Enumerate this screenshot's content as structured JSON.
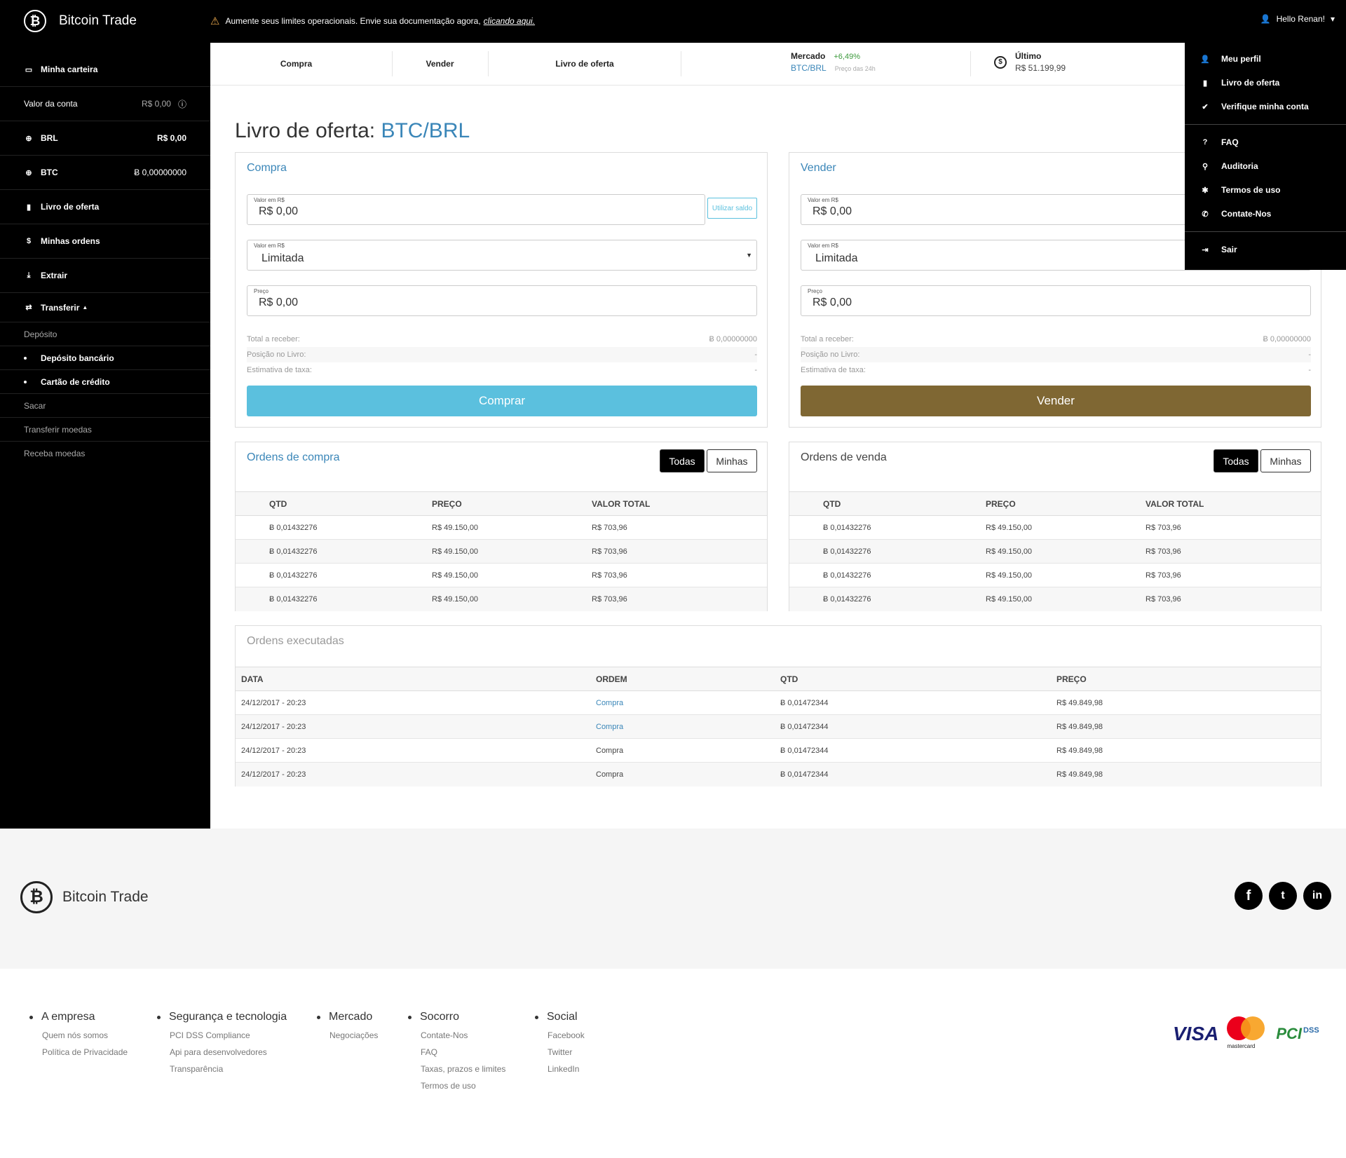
{
  "brand": {
    "name": "Bitcoin Trade",
    "logo_glyph": "₿"
  },
  "alert": {
    "text": "Aumente seus limites operacionais. Envie sua documentação agora,",
    "link": "clicando aqui."
  },
  "user": {
    "greeting": "Hello Renan!"
  },
  "sidebar": {
    "wallet": "Minha carteira",
    "account_value_label": "Valor da conta",
    "account_value": "R$ 0,00",
    "brl_label": "BRL",
    "brl_value": "R$ 0,00",
    "btc_label": "BTC",
    "btc_value": "Ƀ 0,00000000",
    "book": "Livro de oferta",
    "orders": "Minhas ordens",
    "extract": "Extrair",
    "transfer": "Transferir",
    "sub": [
      "Depósito",
      "Depósito bancário",
      "Cartão de crédito",
      "Sacar",
      "Transferir moedas",
      "Receba moedas"
    ]
  },
  "subnav": {
    "tabs": [
      "Compra",
      "Vender",
      "Livro de oferta"
    ],
    "market_label": "Mercado",
    "market_pct": "+6,49%",
    "market_pair": "BTC/BRL",
    "market_sub": "Preço das 24h",
    "last_label": "Último",
    "last_value": "R$ 51.199,99"
  },
  "page": {
    "title": "Livro de oferta:",
    "pair": "BTC/BRL"
  },
  "buy_form": {
    "title": "Compra",
    "value_label": "Valor em R$",
    "value": "R$ 0,00",
    "use_balance": "Utilizar saldo",
    "type_label": "Valor em R$",
    "type_value": "Limitada",
    "price_label": "Preço",
    "price_value": "R$ 0,00",
    "total_label": "Total a receber:",
    "total_value": "Ƀ 0,00000000",
    "position_label": "Posição no Livro:",
    "position_value": "-",
    "fee_label": "Estimativa de taxa:",
    "fee_value": "-",
    "button": "Comprar"
  },
  "sell_form": {
    "title": "Vender",
    "value_label": "Valor em R$",
    "value": "R$ 0,00",
    "type_label": "Valor em R$",
    "type_value": "Limitada",
    "price_label": "Preço",
    "price_value": "R$ 0,00",
    "total_label": "Total a receber:",
    "total_value": "Ƀ 0,00000000",
    "position_label": "Posição no Livro:",
    "position_value": "-",
    "fee_label": "Estimativa de taxa:",
    "fee_value": "-",
    "button": "Vender"
  },
  "buy_orders": {
    "title": "Ordens de compra",
    "all": "Todas",
    "mine": "Minhas",
    "headers": [
      "QTD",
      "PREÇO",
      "VALOR TOTAL"
    ],
    "rows": [
      [
        "Ƀ 0,01432276",
        "R$ 49.150,00",
        "R$ 703,96"
      ],
      [
        "Ƀ 0,01432276",
        "R$ 49.150,00",
        "R$ 703,96"
      ],
      [
        "Ƀ 0,01432276",
        "R$ 49.150,00",
        "R$ 703,96"
      ],
      [
        "Ƀ 0,01432276",
        "R$ 49.150,00",
        "R$ 703,96"
      ]
    ]
  },
  "sell_orders": {
    "title": "Ordens de venda",
    "all": "Todas",
    "mine": "Minhas",
    "headers": [
      "QTD",
      "PREÇO",
      "VALOR TOTAL"
    ],
    "rows": [
      [
        "Ƀ 0,01432276",
        "R$ 49.150,00",
        "R$ 703,96"
      ],
      [
        "Ƀ 0,01432276",
        "R$ 49.150,00",
        "R$ 703,96"
      ],
      [
        "Ƀ 0,01432276",
        "R$ 49.150,00",
        "R$ 703,96"
      ],
      [
        "Ƀ 0,01432276",
        "R$ 49.150,00",
        "R$ 703,96"
      ]
    ]
  },
  "executed": {
    "title": "Ordens executadas",
    "headers": [
      "DATA",
      "ORDEM",
      "QTD",
      "PREÇO"
    ],
    "rows": [
      [
        "24/12/2017 - 20:23",
        "Compra",
        "Ƀ 0,01472344",
        "R$ 49.849,98"
      ],
      [
        "24/12/2017 - 20:23",
        "Compra",
        "Ƀ 0,01472344",
        "R$ 49.849,98"
      ],
      [
        "24/12/2017 - 20:23",
        "Compra",
        "Ƀ 0,01472344",
        "R$ 49.849,98"
      ],
      [
        "24/12/2017 - 20:23",
        "Compra",
        "Ƀ 0,01472344",
        "R$ 49.849,98"
      ]
    ]
  },
  "dropdown": [
    "Meu perfil",
    "Livro de oferta",
    "Verifique minha conta",
    "FAQ",
    "Auditoria",
    "Termos de uso",
    "Contate-Nos",
    "Sair"
  ],
  "footer": {
    "brand": "Bitcoin Trade",
    "social": [
      "f",
      "t",
      "in"
    ],
    "cols": [
      {
        "h": "A empresa",
        "links": [
          "Quem nós somos",
          "Política de Privacidade"
        ]
      },
      {
        "h": "Segurança e tecnologia",
        "links": [
          "PCI DSS Compliance",
          "Api para desenvolvedores",
          "Transparência"
        ]
      },
      {
        "h": "Mercado",
        "links": [
          "Negociações"
        ]
      },
      {
        "h": "Socorro",
        "links": [
          "Contate-Nos",
          "FAQ",
          "Taxas, prazos e limites",
          "Termos de uso"
        ]
      },
      {
        "h": "Social",
        "links": [
          "Facebook",
          "Twitter",
          "LinkedIn"
        ]
      }
    ],
    "visa": "VISA",
    "mastercard": "mastercard",
    "pci": "PCI",
    "dss": "DSS"
  },
  "colors": {
    "accent": "#3a86b8",
    "buy": "#5bc0de",
    "sell": "#7f6733"
  }
}
